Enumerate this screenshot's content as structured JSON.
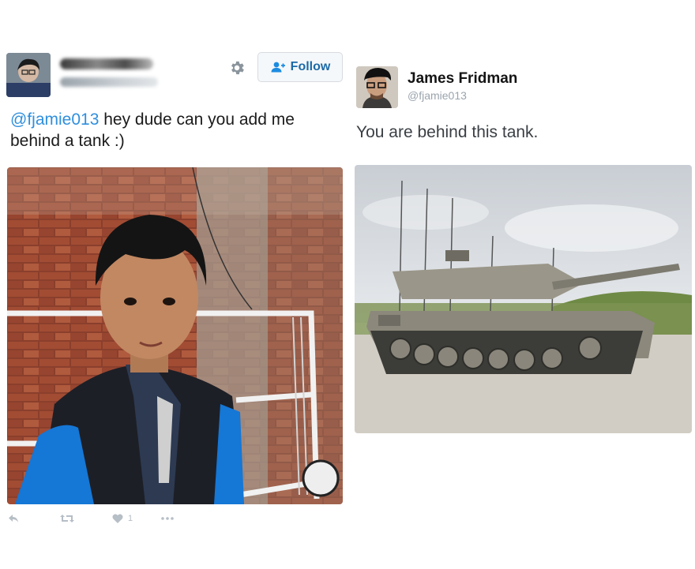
{
  "left_tweet": {
    "follow_label": "Follow",
    "mention": "@fjamie013",
    "text": " hey dude can you add me behind a tank :)",
    "like_count": "1"
  },
  "right_tweet": {
    "name": "James Fridman",
    "handle": "@fjamie013",
    "text": "You are behind this tank."
  },
  "colors": {
    "link": "#2f8fdd",
    "follow_text": "#1c6aa8",
    "action_icons": "#b6bec6"
  },
  "icons": [
    "gear-icon",
    "add-user-icon",
    "reply-icon",
    "retweet-icon",
    "heart-icon",
    "more-icon"
  ]
}
